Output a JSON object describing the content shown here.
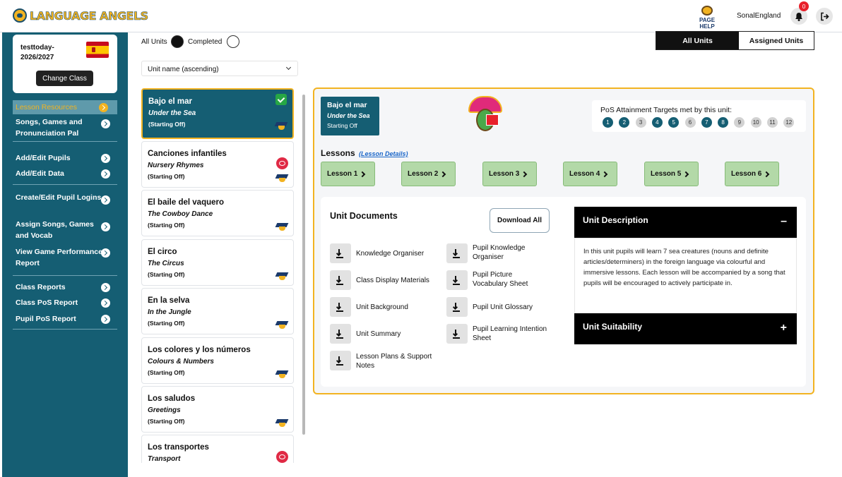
{
  "header": {
    "logo_text": "LANGUAGE ANGELS",
    "page_help": "PAGE HELP",
    "username": "SonalEngland",
    "notification_count": "0"
  },
  "sidebar": {
    "class_name": "testtoday-2026/2027",
    "change_class": "Change Class",
    "items": [
      {
        "label": "Lesson Resources",
        "active": true
      },
      {
        "label": "Songs, Games and Pronunciation Pal"
      },
      {
        "label": "Add/Edit Pupils"
      },
      {
        "label": "Add/Edit Data"
      },
      {
        "label": "Create/Edit Pupil Logins"
      },
      {
        "label": "Assign Songs, Games and Vocab"
      },
      {
        "label": "View Game Performance Report"
      },
      {
        "label": "Class Reports"
      },
      {
        "label": "Class PoS Report"
      },
      {
        "label": "Pupil PoS Report"
      }
    ]
  },
  "filters": {
    "all_units": "All Units",
    "completed": "Completed",
    "sort": "Unit name (ascending)",
    "tab_all": "All Units",
    "tab_assigned": "Assigned Units"
  },
  "units": [
    {
      "title": "Bajo el mar",
      "subtitle": "Under the Sea",
      "level": "(Starting Off)"
    },
    {
      "title": "Canciones infantiles",
      "subtitle": "Nursery Rhymes",
      "level": "(Starting Off)"
    },
    {
      "title": "El baile del vaquero",
      "subtitle": "The Cowboy Dance",
      "level": "(Starting Off)"
    },
    {
      "title": "El circo",
      "subtitle": "The Circus",
      "level": "(Starting Off)"
    },
    {
      "title": "En la selva",
      "subtitle": "In the Jungle",
      "level": "(Starting Off)"
    },
    {
      "title": "Los colores y los números",
      "subtitle": "Colours & Numbers",
      "level": "(Starting Off)"
    },
    {
      "title": "Los saludos",
      "subtitle": "Greetings",
      "level": "(Starting Off)"
    },
    {
      "title": "Los transportes",
      "subtitle": "Transport",
      "level": ""
    }
  ],
  "detail": {
    "unit_title": "Bajo el mar",
    "unit_subtitle": "Under the Sea",
    "unit_level": "Starting Off",
    "pos_title": "PoS Attainment Targets met by this unit:",
    "pos_targets": [
      {
        "n": "1",
        "met": true
      },
      {
        "n": "2",
        "met": true
      },
      {
        "n": "3",
        "met": false
      },
      {
        "n": "4",
        "met": true
      },
      {
        "n": "5",
        "met": true
      },
      {
        "n": "6",
        "met": false
      },
      {
        "n": "7",
        "met": true
      },
      {
        "n": "8",
        "met": true
      },
      {
        "n": "9",
        "met": false
      },
      {
        "n": "10",
        "met": false
      },
      {
        "n": "11",
        "met": false
      },
      {
        "n": "12",
        "met": false
      }
    ],
    "lessons_heading": "Lessons",
    "lesson_details_link": "(Lesson Details)",
    "lessons": [
      "Lesson 1",
      "Lesson 2",
      "Lesson 3",
      "Lesson 4",
      "Lesson 5",
      "Lesson 6"
    ],
    "docs_heading": "Unit Documents",
    "download_all": "Download All",
    "docs_left": [
      "Knowledge Organiser",
      "Class Display Materials",
      "Unit Background",
      "Unit Summary",
      "Lesson Plans & Support Notes"
    ],
    "docs_right": [
      "Pupil Knowledge Organiser",
      "Pupil Picture Vocabulary Sheet",
      "Pupil Unit Glossary",
      "Pupil Learning Intention Sheet"
    ],
    "description_heading": "Unit Description",
    "description": "In this unit pupils will learn 7 sea creatures (nouns and definite articles/determiners) in the foreign language via colourful and immersive lessons. Each lesson will be accompanied by a song that pupils will be encouraged to actively participate in.",
    "suitability_heading": "Unit Suitability"
  },
  "colors": {
    "brand_teal": "#155e73",
    "accent_yellow": "#f2b321",
    "lesson_green": "#b3d9a8"
  }
}
